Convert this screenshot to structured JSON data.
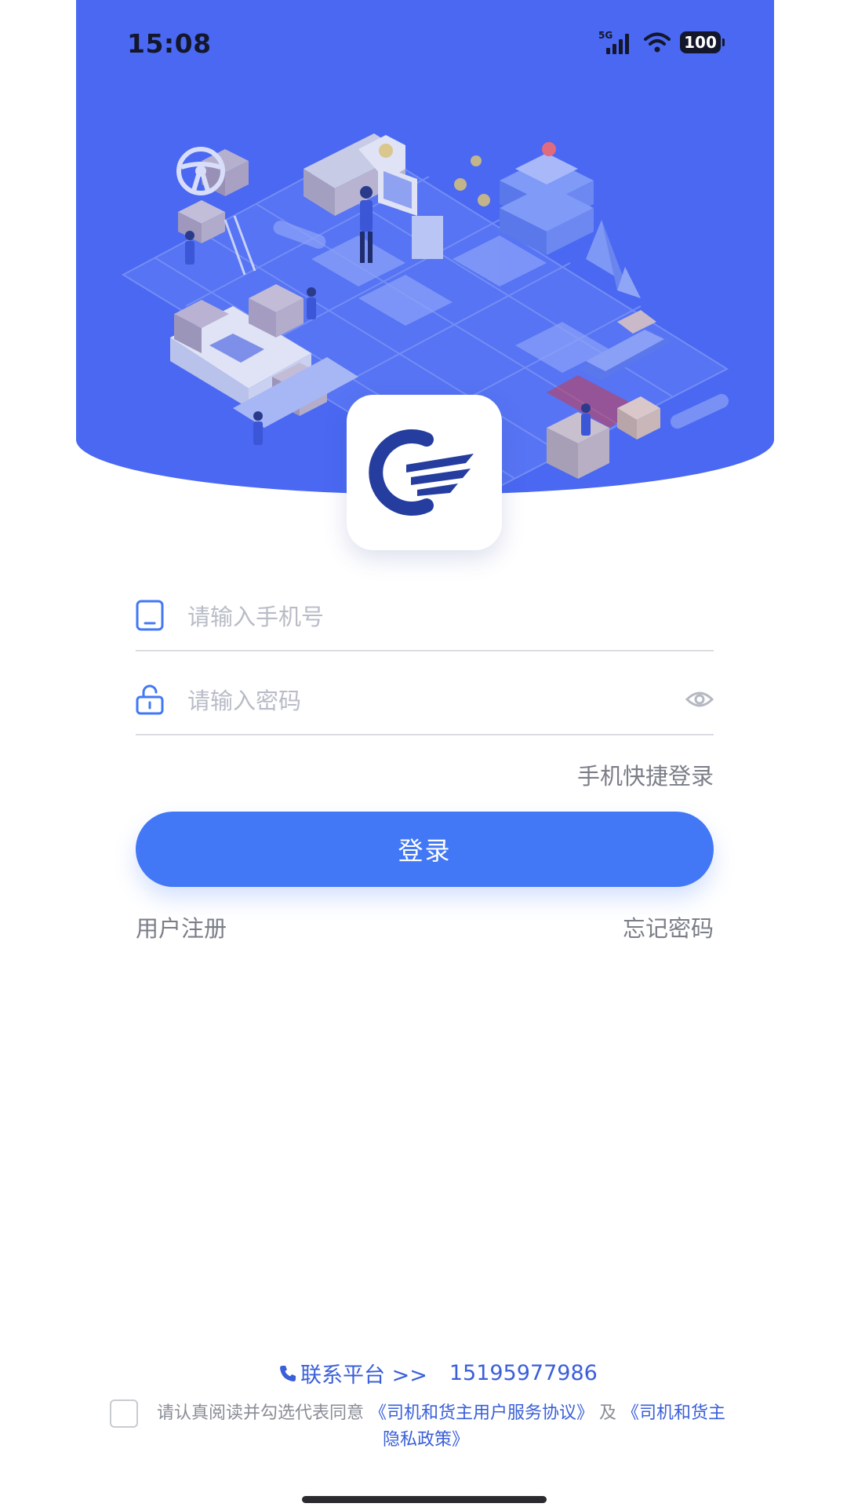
{
  "status_bar": {
    "time": "15:08",
    "network": "5G",
    "battery": "100",
    "icons": [
      "cellular-signal-icon",
      "wifi-icon",
      "battery-icon"
    ]
  },
  "hero": {
    "background_color": "#4a68f2",
    "icons": [
      "steering-wheel-icon",
      "logistics-illustration"
    ]
  },
  "logo": {
    "icon": "company-logo"
  },
  "login_form": {
    "phone_placeholder": "请输入手机号",
    "password_placeholder": "请输入密码",
    "quick_login": "手机快捷登录",
    "login_button": "登录",
    "register": "用户注册",
    "forgot_password": "忘记密码"
  },
  "footer": {
    "contact_label": "联系平台 >>",
    "contact_phone": "15195977986",
    "agreement_prefix": "请认真阅读并勾选代表同意",
    "agreement_link_1": "《司机和货主用户服务协议》",
    "agreement_and": "及",
    "agreement_link_2a": "《司机和货主",
    "agreement_link_2b": "隐私政策》",
    "agreement_checked": false
  },
  "colors": {
    "accent": "#4278f5",
    "link": "#3a5fd9",
    "text_secondary": "#7b7e88"
  }
}
